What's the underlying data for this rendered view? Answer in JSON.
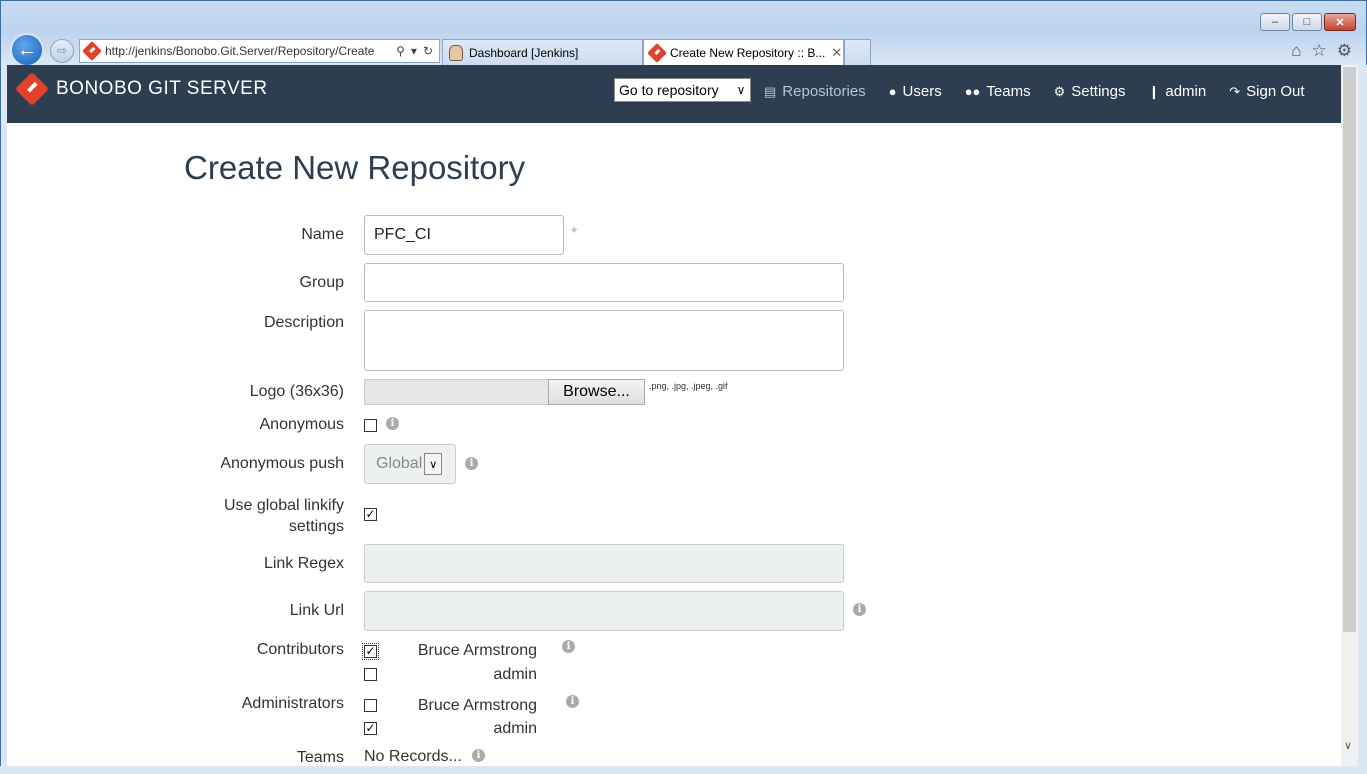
{
  "browser": {
    "address_host": "http://jenkins",
    "address_path": "/Bonobo.Git.Server/Repository/Create",
    "tabs": [
      {
        "label": "Dashboard [Jenkins]"
      },
      {
        "label": "Create New Repository :: B..."
      }
    ],
    "window_buttons": [
      "–",
      "□",
      "✕"
    ]
  },
  "navbar": {
    "brand": "BONOBO GIT SERVER",
    "goto_repository": "Go to repository",
    "links": [
      {
        "label": "Repositories",
        "icon": "hdd-icon"
      },
      {
        "label": "Users",
        "icon": "user-icon"
      },
      {
        "label": "Teams",
        "icon": "users-icon"
      },
      {
        "label": "Settings",
        "icon": "cogs-icon"
      },
      {
        "label": "admin",
        "icon": "person-icon"
      },
      {
        "label": "Sign Out",
        "icon": "signout-icon"
      }
    ]
  },
  "form": {
    "title": "Create New Repository",
    "name_label": "Name",
    "name_value": "PFC_CI",
    "required_mark": "*",
    "group_label": "Group",
    "group_value": "",
    "description_label": "Description",
    "description_value": "",
    "logo_label": "Logo (36x36)",
    "browse_label": "Browse...",
    "logo_hint": ".png, .jpg, .jpeg, .gif",
    "anonymous_label": "Anonymous",
    "anonymous_checked": false,
    "anonymous_push_label": "Anonymous push",
    "anonymous_push_value": "Global",
    "linkify_label_line1": "Use global linkify",
    "linkify_label_line2": "settings",
    "linkify_checked": true,
    "link_regex_label": "Link Regex",
    "link_url_label": "Link Url",
    "contributors_label": "Contributors",
    "contributors": [
      {
        "name": "Bruce Armstrong",
        "checked": true
      },
      {
        "name": "admin",
        "checked": false
      }
    ],
    "administrators_label": "Administrators",
    "administrators": [
      {
        "name": "Bruce Armstrong",
        "checked": false
      },
      {
        "name": "admin",
        "checked": true
      }
    ],
    "teams_label": "Teams",
    "teams_value": "No Records..."
  },
  "colors": {
    "navbar_bg": "#2c3e50",
    "brand_accent": "#e2412c",
    "active_link": "#aec6df"
  }
}
